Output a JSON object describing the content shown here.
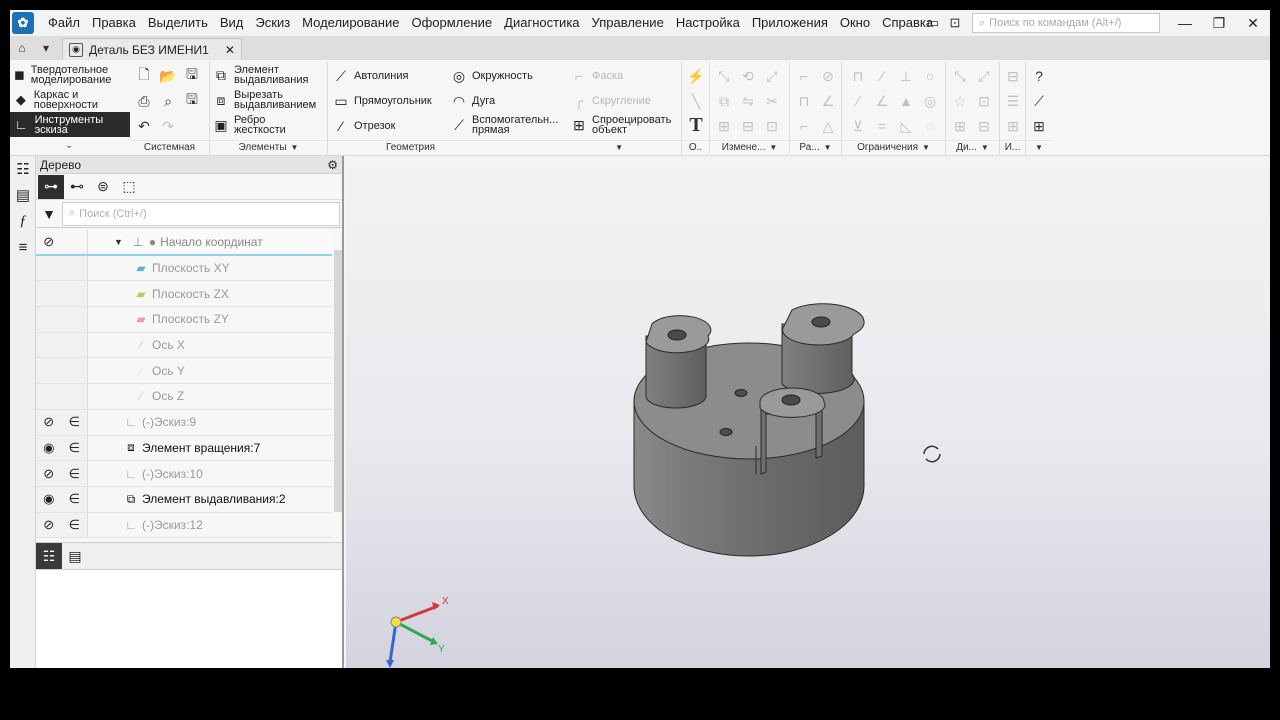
{
  "menubar": {
    "items": [
      "Файл",
      "Правка",
      "Выделить",
      "Вид",
      "Эскиз",
      "Моделирование",
      "Оформление",
      "Диагностика",
      "Управление",
      "Настройка",
      "Приложения",
      "Окно",
      "Справка"
    ],
    "search_placeholder": "Поиск по командам (Alt+/)"
  },
  "tabbar": {
    "doc_title": "Деталь БЕЗ ИМЕНИ1"
  },
  "ribbon": {
    "categories": [
      "Твердотельное моделирование",
      "Каркас и поверхности",
      "Инструменты эскиза"
    ],
    "groups": {
      "system": "Системная",
      "elements": "Элементы",
      "geometry": "Геометрия",
      "o": "О..",
      "edit": "Измене...",
      "ra": "Ра...",
      "constraints": "Ограничения",
      "di": "Ди...",
      "i": "И..."
    },
    "elements_buttons": {
      "extrude": "Элемент выдавливания",
      "cut_extrude": "Вырезать выдавливанием",
      "rib": "Ребро жесткости"
    },
    "geometry_buttons": {
      "autoline": "Автолиния",
      "rectangle": "Прямоугольник",
      "segment": "Отрезок",
      "circle": "Окружность",
      "arc": "Дуга",
      "aux_line": "Вспомогательн... прямая",
      "chamfer": "Фаска",
      "fillet": "Скругление",
      "project": "Спроецировать объект"
    }
  },
  "tree": {
    "title": "Дерево",
    "search_placeholder": "Поиск (Ctrl+/)",
    "rows": [
      {
        "label": "Начало координат"
      },
      {
        "label": "Плоскость XY"
      },
      {
        "label": "Плоскость ZX"
      },
      {
        "label": "Плоскость ZY"
      },
      {
        "label": "Ось X"
      },
      {
        "label": "Ось Y"
      },
      {
        "label": "Ось Z"
      },
      {
        "label": "(-)Эскиз:9"
      },
      {
        "label": "Элемент вращения:7"
      },
      {
        "label": "(-)Эскиз:10"
      },
      {
        "label": "Элемент выдавливания:2"
      },
      {
        "label": "(-)Эскиз:12"
      }
    ]
  },
  "triad": {
    "x_label": "X",
    "y_label": "Y"
  }
}
